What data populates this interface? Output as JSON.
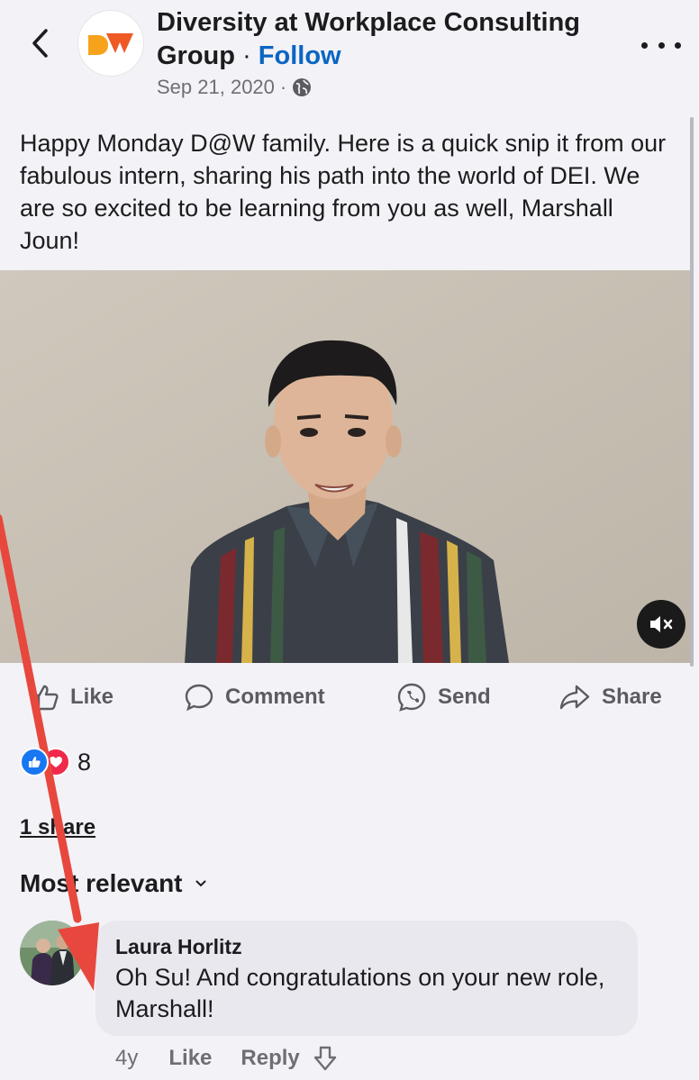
{
  "header": {
    "page_name_line1": "Diversity at Workplace Consulting",
    "page_name_line2": "Group",
    "separator": "·",
    "follow_label": "Follow",
    "date": "Sep 21, 2020",
    "date_separator": "·",
    "privacy_icon": "globe-icon",
    "logo_text": "DW"
  },
  "post": {
    "text": "Happy Monday D@W family. Here is a quick snip it from our fabulous intern, sharing his path into the world of DEI. We are so excited to be learning from you as well, Marshall Joun!"
  },
  "video": {
    "muted": true,
    "mute_icon": "speaker-muted-icon"
  },
  "actions": [
    {
      "label": "Like",
      "icon": "thumbs-up-icon"
    },
    {
      "label": "Comment",
      "icon": "comment-icon"
    },
    {
      "label": "Send",
      "icon": "messenger-icon"
    },
    {
      "label": "Share",
      "icon": "share-arrow-icon"
    }
  ],
  "reactions": {
    "count": "8",
    "types": [
      "like",
      "love"
    ]
  },
  "shares_label": "1 share",
  "sort_label": "Most relevant",
  "comment": {
    "author": "Laura Horlitz",
    "text": "Oh Su!  And congratulations on your new role, Marshall!",
    "age": "4y",
    "like_label": "Like",
    "reply_label": "Reply"
  },
  "colors": {
    "follow": "#0a66c2",
    "annotation_arrow": "#e8473d",
    "like_reaction": "#1877f2",
    "love_reaction": "#f02849"
  }
}
